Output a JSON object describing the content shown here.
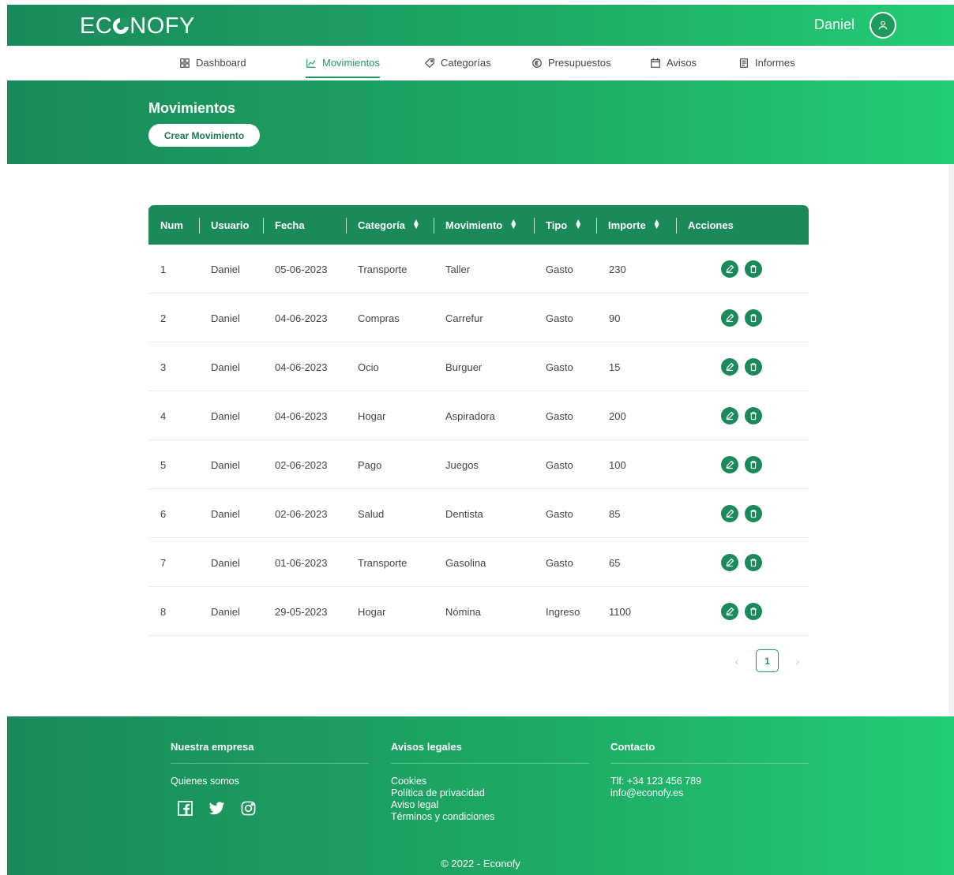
{
  "header": {
    "logo": "ECONOFY",
    "logo_parts": [
      "EC",
      "NOFY"
    ],
    "user_name": "Daniel",
    "avatar_icon": "user-icon"
  },
  "nav": {
    "items": [
      {
        "label": "Dashboard",
        "icon": "grid-icon",
        "active": false
      },
      {
        "label": "Movimientos",
        "icon": "line-chart-icon",
        "active": true
      },
      {
        "label": "Categorías",
        "icon": "tag-icon",
        "active": false
      },
      {
        "label": "Presupuestos",
        "icon": "euro-icon",
        "active": false
      },
      {
        "label": "Avisos",
        "icon": "calendar-icon",
        "active": false
      },
      {
        "label": "Informes",
        "icon": "document-icon",
        "active": false
      }
    ]
  },
  "page": {
    "title": "Movimientos",
    "create_button": "Crear Movimiento"
  },
  "table": {
    "columns": [
      "Num",
      "Usuario",
      "Fecha",
      "Categoría",
      "Movimiento",
      "Tipo",
      "Importe",
      "Acciones"
    ],
    "sortable": [
      false,
      false,
      false,
      true,
      true,
      true,
      true,
      false
    ],
    "rows": [
      {
        "num": "1",
        "usuario": "Daniel",
        "fecha": "05-06-2023",
        "categoria": "Transporte",
        "movimiento": "Taller",
        "tipo": "Gasto",
        "importe": "230"
      },
      {
        "num": "2",
        "usuario": "Daniel",
        "fecha": "04-06-2023",
        "categoria": "Compras",
        "movimiento": "Carrefur",
        "tipo": "Gasto",
        "importe": "90"
      },
      {
        "num": "3",
        "usuario": "Daniel",
        "fecha": "04-06-2023",
        "categoria": "Ocio",
        "movimiento": "Burguer",
        "tipo": "Gasto",
        "importe": "15"
      },
      {
        "num": "4",
        "usuario": "Daniel",
        "fecha": "04-06-2023",
        "categoria": "Hogar",
        "movimiento": "Aspiradora",
        "tipo": "Gasto",
        "importe": "200"
      },
      {
        "num": "5",
        "usuario": "Daniel",
        "fecha": "02-06-2023",
        "categoria": "Pago",
        "movimiento": "Juegos",
        "tipo": "Gasto",
        "importe": "100"
      },
      {
        "num": "6",
        "usuario": "Daniel",
        "fecha": "02-06-2023",
        "categoria": "Salud",
        "movimiento": "Dentista",
        "tipo": "Gasto",
        "importe": "85"
      },
      {
        "num": "7",
        "usuario": "Daniel",
        "fecha": "01-06-2023",
        "categoria": "Transporte",
        "movimiento": "Gasolina",
        "tipo": "Gasto",
        "importe": "65"
      },
      {
        "num": "8",
        "usuario": "Daniel",
        "fecha": "29-05-2023",
        "categoria": "Hogar",
        "movimiento": "Nómina",
        "tipo": "Ingreso",
        "importe": "1100"
      }
    ],
    "action_icons": [
      "edit-icon",
      "trash-icon"
    ]
  },
  "pagination": {
    "current_page": "1",
    "prev_icon": "chevron-left-icon",
    "next_icon": "chevron-right-icon"
  },
  "footer": {
    "col1": {
      "title": "Nuestra empresa",
      "links": [
        "Quienes somos"
      ],
      "social_icons": [
        "facebook-icon",
        "twitter-icon",
        "instagram-icon"
      ]
    },
    "col2": {
      "title": "Avisos legales",
      "links": [
        "Cookies",
        "Política de privacidad",
        "Aviso legal",
        "Términos y condiciones"
      ]
    },
    "col3": {
      "title": "Contacto",
      "lines": [
        "Tlf: +34 123 456 789",
        "info@econofy.es"
      ]
    },
    "copyright": "© 2022 - Econofy"
  },
  "colors": {
    "brand": "#1b8a59",
    "brand_light": "#22cc76",
    "accent": "#1e9a5e"
  }
}
